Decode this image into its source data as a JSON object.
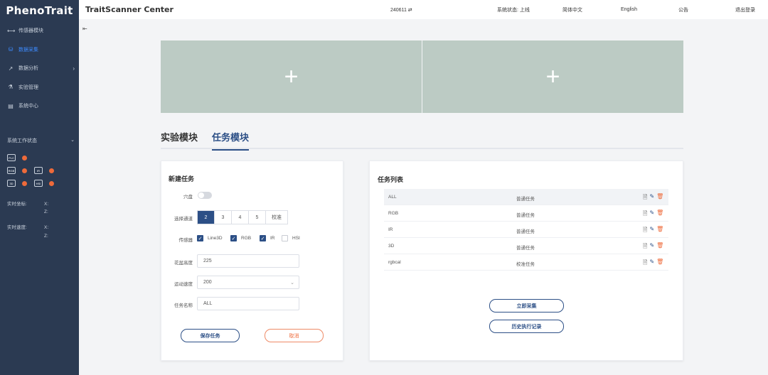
{
  "sidebar": {
    "logo": "PhenoTrait",
    "nav": [
      {
        "icon": "sensor-icon",
        "glyph": "⟷",
        "label": "传感器模块",
        "active": false,
        "chevron": ""
      },
      {
        "icon": "capture-icon",
        "glyph": "⛁",
        "label": "数据采集",
        "active": true,
        "chevron": ""
      },
      {
        "icon": "chart-icon",
        "glyph": "↗",
        "label": "数据分析",
        "active": false,
        "chevron": "›"
      },
      {
        "icon": "experiment-icon",
        "glyph": "⚗",
        "label": "实验管理",
        "active": false,
        "chevron": ""
      },
      {
        "icon": "system-icon",
        "glyph": "▤",
        "label": "系统中心",
        "active": false,
        "chevron": ""
      }
    ],
    "status_title": "系统工作状态",
    "status_chevron": "⌄",
    "devices": {
      "plc": "PLC",
      "rgb": "RGB",
      "ir": "IR",
      "d3": "3D",
      "hsi": "HSI"
    },
    "realtime_coord_label": "实时坐标:",
    "realtime_speed_label": "实时速度:",
    "x_label": "X:",
    "z_label": "Z:"
  },
  "topbar": {
    "title": "TraitScanner Center",
    "device_id": "240611 ⇄",
    "system_status": "系统状态: 上线",
    "lang_zh": "简体中文",
    "lang_en": "English",
    "notice": "公告",
    "logout": "退出登录"
  },
  "main": {
    "collapse_glyph": "⇤",
    "cam_add": "+",
    "tabs": [
      "实验模块",
      "任务模块"
    ],
    "new_task": {
      "title": "新建任务",
      "hole_label": "穴盘",
      "channel_label": "选择通道",
      "channels": [
        "2",
        "3",
        "4",
        "5",
        "校准"
      ],
      "sensor_label": "传感器",
      "sensors": [
        {
          "name": "Line3D",
          "checked": true
        },
        {
          "name": "RGB",
          "checked": true
        },
        {
          "name": "IR",
          "checked": true
        },
        {
          "name": "HSI",
          "checked": false
        }
      ],
      "height_label": "花盆高度",
      "height_value": "225",
      "speed_label": "运动速度",
      "speed_value": "200",
      "name_label": "任务名称",
      "name_value": "ALL",
      "save_label": "保存任务",
      "cancel_label": "取消"
    },
    "task_list": {
      "title": "任务列表",
      "rows": [
        {
          "name": "ALL",
          "type": "普通任务"
        },
        {
          "name": "RGB",
          "type": "普通任务"
        },
        {
          "name": "IR",
          "type": "普通任务"
        },
        {
          "name": "3D",
          "type": "普通任务"
        },
        {
          "name": "rgbcal",
          "type": "校准任务"
        }
      ],
      "collect_label": "立即采集",
      "history_label": "历史执行记录"
    }
  }
}
